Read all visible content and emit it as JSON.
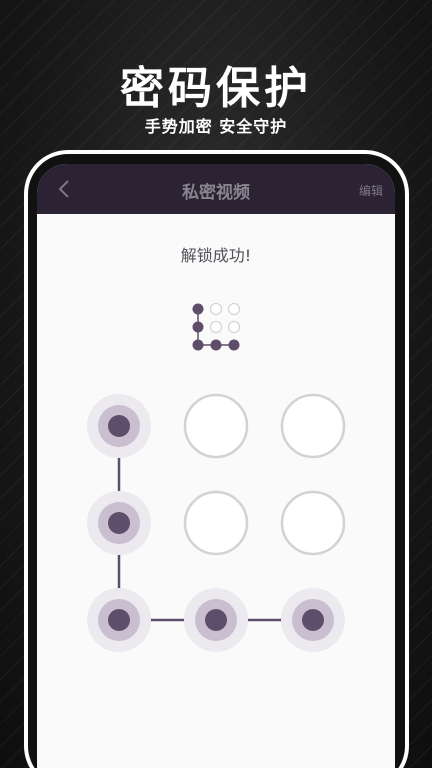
{
  "hero": {
    "title": "密码保护",
    "subtitle": "手势加密 安全守护"
  },
  "navbar": {
    "back_icon": "chevron-left-icon",
    "title": "私密视频",
    "edit_label": "编辑"
  },
  "unlock": {
    "status_text": "解锁成功!"
  },
  "pattern": {
    "selected_nodes": [
      1,
      4,
      7,
      8,
      9
    ],
    "active_color": "#5e4e6b",
    "inactive_border_color": "#d3d1d5"
  },
  "colors": {
    "navbar_bg": "#2b2333",
    "screen_bg": "#fafafa"
  }
}
